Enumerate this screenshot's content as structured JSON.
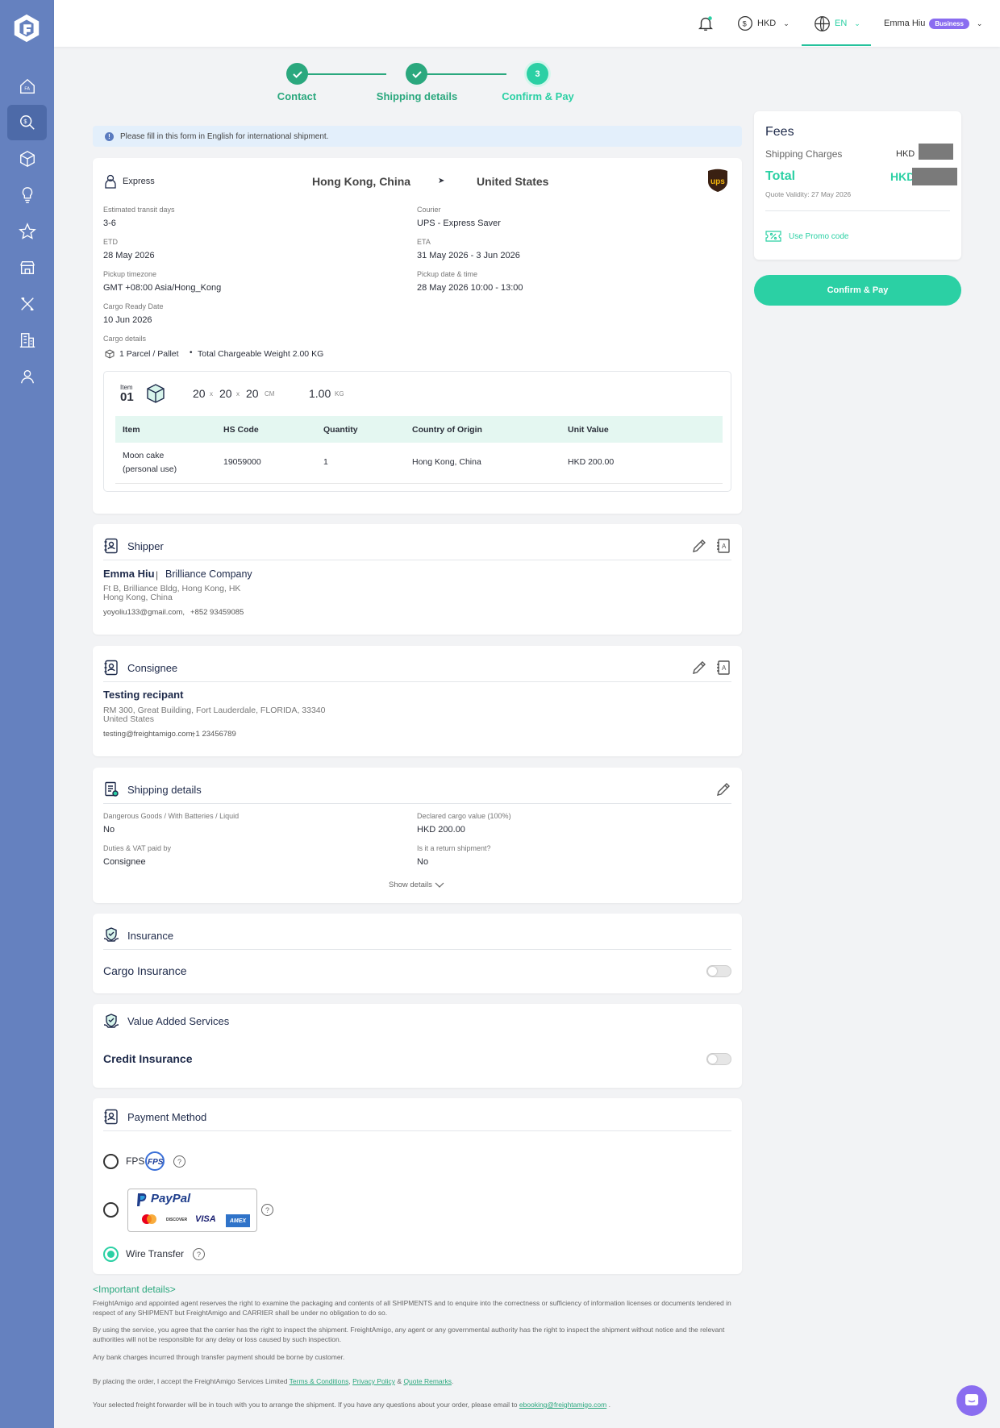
{
  "topbar": {
    "currency": "HKD",
    "language": "EN",
    "user_name": "Emma Hiu",
    "user_badge": "Business"
  },
  "steps": [
    {
      "number": "1",
      "label": "Contact",
      "state": "done"
    },
    {
      "number": "2",
      "label": "Shipping details",
      "state": "done"
    },
    {
      "number": "3",
      "label": "Confirm & Pay",
      "state": "current"
    }
  ],
  "notice": "Please fill in this form in English for international shipment.",
  "shipment": {
    "service": "Express",
    "origin": "Hong Kong, China",
    "destination": "United States",
    "courier_logo": "ups",
    "fields": {
      "transit_label": "Estimated transit days",
      "transit_value": "3-6",
      "courier_label": "Courier",
      "courier_value": "UPS - Express Saver",
      "etd_label": "ETD",
      "etd_value": "28 May 2026",
      "eta_label": "ETA",
      "eta_value": "31 May 2026 - 3 Jun 2026",
      "pickup_tz_label": "Pickup timezone",
      "pickup_tz_value": "GMT +08:00 Asia/Hong_Kong",
      "pickup_dt_label": "Pickup date & time",
      "pickup_dt_value": "28 May 2026 10:00 - 13:00",
      "ready_label": "Cargo Ready Date",
      "ready_value": "10 Jun 2026",
      "cargo_label": "Cargo details",
      "cargo_value": "1 Parcel / Pallet",
      "cargo_weight": "Total Chargeable Weight 2.00 KG"
    },
    "item": {
      "item_word": "Item",
      "item_no": "01",
      "dim_l": "20",
      "dim_w": "20",
      "dim_h": "20",
      "x": "x",
      "dim_unit": "CM",
      "weight": "1.00",
      "weight_unit": "KG"
    },
    "table": {
      "headers": [
        "Item",
        "HS Code",
        "Quantity",
        "Country of Origin",
        "Unit Value"
      ],
      "rows": [
        [
          "Moon cake (personal use)",
          "19059000",
          "1",
          "Hong Kong, China",
          "HKD 200.00"
        ]
      ]
    }
  },
  "shipper": {
    "title": "Shipper",
    "name": "Emma Hiu",
    "separator": "|",
    "company": "Brilliance Company",
    "address1": "Ft B, Brilliance Bldg, Hong Kong, HK",
    "address2": "Hong Kong, China",
    "email": "yoyoliu133@gmail.com,",
    "phone": "+852 93459085"
  },
  "consignee": {
    "title": "Consignee",
    "name": "Testing recipant",
    "address1": "RM 300, Great Building, Fort Lauderdale, FLORIDA, 33340",
    "address2": "United States",
    "email": "testing@freightamigo.com,",
    "phone": "+1 23456789"
  },
  "shipping_details": {
    "title": "Shipping details",
    "dg_label": "Dangerous Goods / With Batteries / Liquid",
    "dg_value": "No",
    "declared_label": "Declared cargo value (100%)",
    "declared_value": "HKD 200.00",
    "duties_label": "Duties & VAT paid by",
    "duties_value": "Consignee",
    "return_label": "Is it a return shipment?",
    "return_value": "No",
    "show_details": "Show details"
  },
  "insurance": {
    "title": "Insurance",
    "option": "Cargo Insurance",
    "enabled": false
  },
  "vas": {
    "title": "Value Added Services",
    "option": "Credit Insurance",
    "enabled": false
  },
  "payment": {
    "title": "Payment Method",
    "fps_label": "FPS",
    "fps_logo": "FPS",
    "paypal_logo": "PayPal",
    "card_logos": [
      "mastercard",
      "DISCOVER",
      "VISA",
      "AMEX"
    ],
    "wire_label": "Wire Transfer",
    "help": "?",
    "selected": "Wire Transfer"
  },
  "fees": {
    "title": "Fees",
    "shipping_label": "Shipping Charges",
    "shipping_currency": "HKD",
    "total_label": "Total",
    "total_currency": "HKD",
    "validity": "Quote Validity: 27 May 2026",
    "promo": "Use Promo code"
  },
  "confirm_button": "Confirm & Pay",
  "important": {
    "lt": "<",
    "title": "Important details",
    "gt": ">",
    "p1": "FreightAmigo and appointed agent reserves the right to examine the packaging and contents of all SHIPMENTS and to enquire into the correctness or sufficiency of information licenses or documents tendered in respect of any SHIPMENT but FreightAmigo and CARRIER shall be under no obligation to do so.",
    "p2": "By using the service, you agree that the carrier has the right to inspect the shipment. FreightAmigo, any agent or any governmental authority has the right to inspect the shipment without notice and the relevant authorities will not be responsible for any delay or loss caused by such inspection.",
    "p3": "Any bank charges incurred through transfer payment should be borne by customer.",
    "accept_prefix": "By placing the order, I accept the FreightAmigo Services Limited",
    "terms": "Terms & Conditions",
    "comma": ",",
    "privacy": "Privacy Policy",
    "amp": "&",
    "remarks": "Quote Remarks",
    "period": ".",
    "contact_prefix": "Your selected freight forwarder will be in touch with you to arrange the shipment. If you have any questions about your order, please email to",
    "email": "ebooking@freightamigo.com",
    "contact_suffix": "."
  },
  "colors": {
    "sidebar": "#6581bf",
    "accent": "#2bd0a4",
    "done": "#2ba87e",
    "badge": "#8a6df0"
  }
}
